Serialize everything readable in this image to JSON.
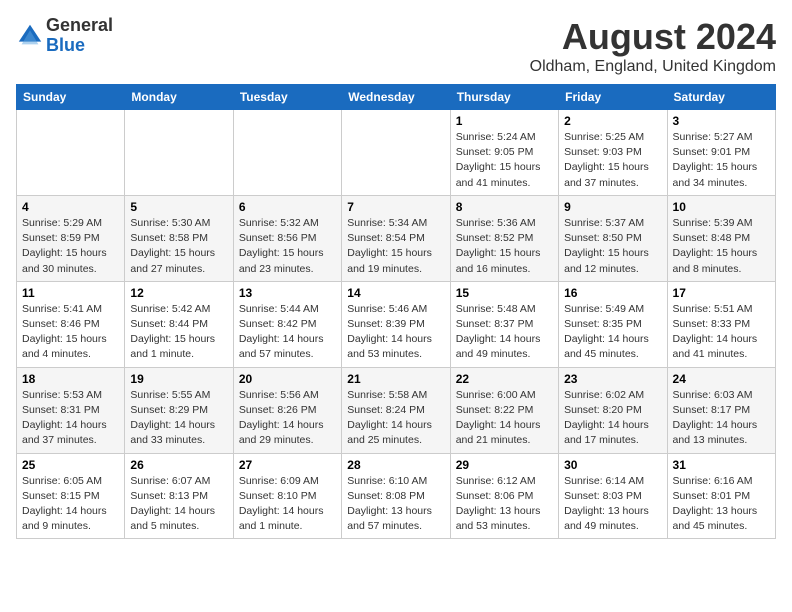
{
  "logo": {
    "general": "General",
    "blue": "Blue"
  },
  "title": "August 2024",
  "location": "Oldham, England, United Kingdom",
  "days_of_week": [
    "Sunday",
    "Monday",
    "Tuesday",
    "Wednesday",
    "Thursday",
    "Friday",
    "Saturday"
  ],
  "weeks": [
    [
      {
        "day": "",
        "info": ""
      },
      {
        "day": "",
        "info": ""
      },
      {
        "day": "",
        "info": ""
      },
      {
        "day": "",
        "info": ""
      },
      {
        "day": "1",
        "sunrise": "5:24 AM",
        "sunset": "9:05 PM",
        "daylight": "15 hours and 41 minutes."
      },
      {
        "day": "2",
        "sunrise": "5:25 AM",
        "sunset": "9:03 PM",
        "daylight": "15 hours and 37 minutes."
      },
      {
        "day": "3",
        "sunrise": "5:27 AM",
        "sunset": "9:01 PM",
        "daylight": "15 hours and 34 minutes."
      }
    ],
    [
      {
        "day": "4",
        "sunrise": "5:29 AM",
        "sunset": "8:59 PM",
        "daylight": "15 hours and 30 minutes."
      },
      {
        "day": "5",
        "sunrise": "5:30 AM",
        "sunset": "8:58 PM",
        "daylight": "15 hours and 27 minutes."
      },
      {
        "day": "6",
        "sunrise": "5:32 AM",
        "sunset": "8:56 PM",
        "daylight": "15 hours and 23 minutes."
      },
      {
        "day": "7",
        "sunrise": "5:34 AM",
        "sunset": "8:54 PM",
        "daylight": "15 hours and 19 minutes."
      },
      {
        "day": "8",
        "sunrise": "5:36 AM",
        "sunset": "8:52 PM",
        "daylight": "15 hours and 16 minutes."
      },
      {
        "day": "9",
        "sunrise": "5:37 AM",
        "sunset": "8:50 PM",
        "daylight": "15 hours and 12 minutes."
      },
      {
        "day": "10",
        "sunrise": "5:39 AM",
        "sunset": "8:48 PM",
        "daylight": "15 hours and 8 minutes."
      }
    ],
    [
      {
        "day": "11",
        "sunrise": "5:41 AM",
        "sunset": "8:46 PM",
        "daylight": "15 hours and 4 minutes."
      },
      {
        "day": "12",
        "sunrise": "5:42 AM",
        "sunset": "8:44 PM",
        "daylight": "15 hours and 1 minute."
      },
      {
        "day": "13",
        "sunrise": "5:44 AM",
        "sunset": "8:42 PM",
        "daylight": "14 hours and 57 minutes."
      },
      {
        "day": "14",
        "sunrise": "5:46 AM",
        "sunset": "8:39 PM",
        "daylight": "14 hours and 53 minutes."
      },
      {
        "day": "15",
        "sunrise": "5:48 AM",
        "sunset": "8:37 PM",
        "daylight": "14 hours and 49 minutes."
      },
      {
        "day": "16",
        "sunrise": "5:49 AM",
        "sunset": "8:35 PM",
        "daylight": "14 hours and 45 minutes."
      },
      {
        "day": "17",
        "sunrise": "5:51 AM",
        "sunset": "8:33 PM",
        "daylight": "14 hours and 41 minutes."
      }
    ],
    [
      {
        "day": "18",
        "sunrise": "5:53 AM",
        "sunset": "8:31 PM",
        "daylight": "14 hours and 37 minutes."
      },
      {
        "day": "19",
        "sunrise": "5:55 AM",
        "sunset": "8:29 PM",
        "daylight": "14 hours and 33 minutes."
      },
      {
        "day": "20",
        "sunrise": "5:56 AM",
        "sunset": "8:26 PM",
        "daylight": "14 hours and 29 minutes."
      },
      {
        "day": "21",
        "sunrise": "5:58 AM",
        "sunset": "8:24 PM",
        "daylight": "14 hours and 25 minutes."
      },
      {
        "day": "22",
        "sunrise": "6:00 AM",
        "sunset": "8:22 PM",
        "daylight": "14 hours and 21 minutes."
      },
      {
        "day": "23",
        "sunrise": "6:02 AM",
        "sunset": "8:20 PM",
        "daylight": "14 hours and 17 minutes."
      },
      {
        "day": "24",
        "sunrise": "6:03 AM",
        "sunset": "8:17 PM",
        "daylight": "14 hours and 13 minutes."
      }
    ],
    [
      {
        "day": "25",
        "sunrise": "6:05 AM",
        "sunset": "8:15 PM",
        "daylight": "14 hours and 9 minutes."
      },
      {
        "day": "26",
        "sunrise": "6:07 AM",
        "sunset": "8:13 PM",
        "daylight": "14 hours and 5 minutes."
      },
      {
        "day": "27",
        "sunrise": "6:09 AM",
        "sunset": "8:10 PM",
        "daylight": "14 hours and 1 minute."
      },
      {
        "day": "28",
        "sunrise": "6:10 AM",
        "sunset": "8:08 PM",
        "daylight": "13 hours and 57 minutes."
      },
      {
        "day": "29",
        "sunrise": "6:12 AM",
        "sunset": "8:06 PM",
        "daylight": "13 hours and 53 minutes."
      },
      {
        "day": "30",
        "sunrise": "6:14 AM",
        "sunset": "8:03 PM",
        "daylight": "13 hours and 49 minutes."
      },
      {
        "day": "31",
        "sunrise": "6:16 AM",
        "sunset": "8:01 PM",
        "daylight": "13 hours and 45 minutes."
      }
    ]
  ],
  "labels": {
    "sunrise": "Sunrise:",
    "sunset": "Sunset:",
    "daylight": "Daylight hours"
  }
}
